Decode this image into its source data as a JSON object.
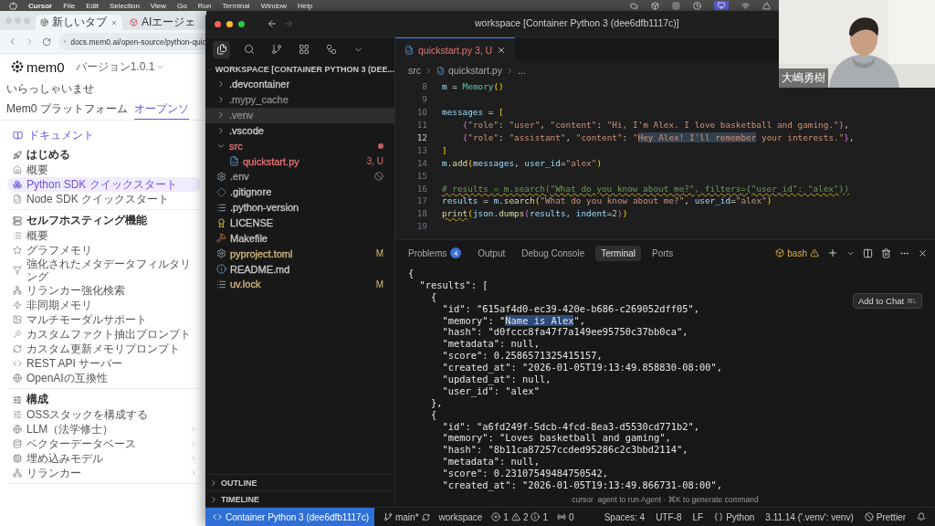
{
  "menubar": {
    "app": "Cursor",
    "items": [
      "File",
      "Edit",
      "Selection",
      "View",
      "Go",
      "Run",
      "Terminal",
      "Window",
      "Help"
    ]
  },
  "browser": {
    "tabs": [
      {
        "label": "新しいタブ",
        "selected": true
      },
      {
        "label": "AIエージェ",
        "selected": false
      }
    ],
    "url": "docs.mem0.ai/open-source/python-quic",
    "logo": "mem0",
    "version": "バージョン1.0.1",
    "nav": [
      {
        "label": "いらっしゃいませ",
        "selected": false
      },
      {
        "label": "Mem0 プラットフォーム",
        "selected": false
      },
      {
        "label": "オープンソ",
        "selected": true
      }
    ],
    "docs_link": "ドキュメント",
    "sections": [
      {
        "title": "はじめる",
        "items": [
          {
            "label": "概要",
            "selected": false
          },
          {
            "label": "Python SDK クイックスタート",
            "selected": true
          },
          {
            "label": "Node SDK クイックスタート",
            "selected": false
          }
        ]
      },
      {
        "title": "セルフホスティング機能",
        "items": [
          {
            "label": "概要",
            "selected": false
          },
          {
            "label": "グラフメモリ",
            "selected": false
          },
          {
            "label": "強化されたメタデータフィルタリング",
            "selected": false
          },
          {
            "label": "リランカー強化検索",
            "selected": false
          },
          {
            "label": "非同期メモリ",
            "selected": false
          },
          {
            "label": "マルチモーダルサポート",
            "selected": false
          },
          {
            "label": "カスタムファクト抽出プロンプト",
            "selected": false
          },
          {
            "label": "カスタム更新メモリプロンプト",
            "selected": false
          },
          {
            "label": "REST API サーバー",
            "selected": false
          },
          {
            "label": "OpenAIの互換性",
            "selected": false
          }
        ]
      },
      {
        "title": "構成",
        "items": [
          {
            "label": "OSSスタックを構成する",
            "selected": false,
            "expandable": false
          },
          {
            "label": "LLM（法学修士）",
            "selected": false,
            "expandable": true
          },
          {
            "label": "ベクターデータベース",
            "selected": false,
            "expandable": true
          },
          {
            "label": "埋め込みモデル",
            "selected": false,
            "expandable": true
          },
          {
            "label": "リランカー",
            "selected": false,
            "expandable": true
          }
        ]
      }
    ]
  },
  "editor": {
    "title": "workspace [Container Python 3 (dee6dfb1117c)]",
    "explorer": {
      "root": "WORKSPACE [CONTAINER PYTHON 3 (DEE...",
      "expanded": true,
      "items": [
        {
          "kind": "folder",
          "name": ".devcontainer",
          "expanded": false,
          "color": "#cccccc",
          "dot": false,
          "excluded": false,
          "selected": false
        },
        {
          "kind": "folder",
          "name": ".mypy_cache",
          "expanded": false,
          "color": "#8a8a8a",
          "dot": false,
          "excluded": false,
          "selected": false
        },
        {
          "kind": "folder",
          "name": ".venv",
          "expanded": false,
          "color": "#8a8a8a",
          "dot": false,
          "excluded": false,
          "selected": true
        },
        {
          "kind": "folder",
          "name": ".vscode",
          "expanded": false,
          "color": "#cccccc",
          "dot": false,
          "excluded": false,
          "selected": false
        },
        {
          "kind": "folder",
          "name": "src",
          "expanded": true,
          "color": "#e57373",
          "dot": true,
          "excluded": false,
          "selected": false,
          "children": [
            {
              "kind": "python",
              "name": "quickstart.py",
              "color": "#e57373",
              "badge": "3, U",
              "dot": false,
              "excluded": false,
              "selected": false
            }
          ]
        },
        {
          "kind": "config",
          "name": ".env",
          "color": "#a0a0a0",
          "dot": false,
          "excluded": true,
          "selected": false
        },
        {
          "kind": "git",
          "name": ".gitignore",
          "color": "#cccccc",
          "dot": false,
          "excluded": false,
          "selected": false
        },
        {
          "kind": "text",
          "name": ".python-version",
          "color": "#cccccc",
          "dot": false,
          "excluded": false,
          "selected": false
        },
        {
          "kind": "license",
          "name": "LICENSE",
          "color": "#cccccc",
          "dot": false,
          "excluded": false,
          "selected": false
        },
        {
          "kind": "makefile",
          "name": "Makefile",
          "color": "#cccccc",
          "dot": false,
          "excluded": false,
          "selected": false
        },
        {
          "kind": "config",
          "name": "pyproject.toml",
          "color": "#d7ba7d",
          "badge": "M",
          "dot": false,
          "excluded": false,
          "selected": false
        },
        {
          "kind": "info",
          "name": "README.md",
          "color": "#cccccc",
          "dot": false,
          "excluded": false,
          "selected": false
        },
        {
          "kind": "text",
          "name": "uv.lock",
          "color": "#d7ba7d",
          "badge": "M",
          "dot": false,
          "excluded": false,
          "selected": false
        }
      ]
    },
    "outline_sections": [
      "OUTLINE",
      "TIMELINE"
    ],
    "tab": {
      "label": "quickstart.py",
      "badge": "3, U"
    },
    "breadcrumb": [
      "src",
      "quickstart.py",
      "..."
    ],
    "code": [
      {
        "number": "8",
        "current": false,
        "tokens": [
          {
            "kind": "var",
            "text": "m"
          },
          {
            "kind": "plain",
            "text": " = "
          },
          {
            "kind": "cls",
            "text": "Memory"
          },
          {
            "kind": "bracket",
            "text": "()"
          }
        ]
      },
      {
        "number": "9",
        "current": false
      },
      {
        "number": "10",
        "current": false,
        "tokens": [
          {
            "kind": "var",
            "text": "messages"
          },
          {
            "kind": "plain",
            "text": " = "
          },
          {
            "kind": "bracket",
            "text": "["
          }
        ]
      },
      {
        "number": "11",
        "current": false,
        "tokens": [
          {
            "kind": "brace",
            "text": "    {"
          },
          {
            "kind": "str",
            "text": "\"role\""
          },
          {
            "kind": "plain",
            "text": ": "
          },
          {
            "kind": "str",
            "text": "\"user\""
          },
          {
            "kind": "plain",
            "text": ", "
          },
          {
            "kind": "str",
            "text": "\"content\""
          },
          {
            "kind": "plain",
            "text": ": "
          },
          {
            "kind": "str",
            "text": "\"Hi, I'm Alex. I love basketball and gaming.\""
          },
          {
            "kind": "brace",
            "text": "}"
          },
          {
            "kind": "plain",
            "text": ","
          }
        ]
      },
      {
        "number": "12",
        "current": true,
        "tokens": [
          {
            "kind": "brace",
            "text": "    {"
          },
          {
            "kind": "str",
            "text": "\"role\""
          },
          {
            "kind": "plain",
            "text": ": "
          },
          {
            "kind": "str",
            "text": "\"assistant\""
          },
          {
            "kind": "plain",
            "text": ", "
          },
          {
            "kind": "str",
            "text": "\"content\""
          },
          {
            "kind": "plain",
            "text": ": "
          },
          {
            "kind": "str",
            "text": "\""
          },
          {
            "kind": "sel",
            "text": "Hey Alex! I'll remember"
          },
          {
            "kind": "str",
            "text": " your interests.\""
          },
          {
            "kind": "brace",
            "text": "}"
          },
          {
            "kind": "plain",
            "text": ","
          }
        ]
      },
      {
        "number": "13",
        "current": false,
        "tokens": [
          {
            "kind": "bracket",
            "text": "]"
          }
        ]
      },
      {
        "number": "14",
        "current": false,
        "tokens": [
          {
            "kind": "var",
            "text": "m"
          },
          {
            "kind": "plain",
            "text": "."
          },
          {
            "kind": "fn",
            "text": "add"
          },
          {
            "kind": "bracket",
            "text": "("
          },
          {
            "kind": "var",
            "text": "messages"
          },
          {
            "kind": "plain",
            "text": ", "
          },
          {
            "kind": "var",
            "text": "user_id"
          },
          {
            "kind": "plain",
            "text": "="
          },
          {
            "kind": "str",
            "text": "\"alex\""
          },
          {
            "kind": "bracket",
            "text": ")"
          }
        ]
      },
      {
        "number": "15",
        "current": false
      },
      {
        "number": "16",
        "current": false,
        "tokens": [
          {
            "kind": "comment",
            "text": "# results = m.search(\"What do you know about me?\", filters={\"user_id\": \"alex\"})"
          }
        ]
      },
      {
        "number": "17",
        "current": false,
        "tokens": [
          {
            "kind": "var",
            "text": "results"
          },
          {
            "kind": "plain",
            "text": " = "
          },
          {
            "kind": "var",
            "text": "m"
          },
          {
            "kind": "plain",
            "text": "."
          },
          {
            "kind": "fn",
            "text": "search"
          },
          {
            "kind": "bracket",
            "text": "("
          },
          {
            "kind": "str",
            "text": "\"What do you know about me?\""
          },
          {
            "kind": "plain",
            "text": ", "
          },
          {
            "kind": "var",
            "text": "user_id"
          },
          {
            "kind": "plain",
            "text": "="
          },
          {
            "kind": "str",
            "text": "\"alex\""
          },
          {
            "kind": "bracket",
            "text": ")"
          }
        ]
      },
      {
        "number": "18",
        "current": false,
        "tokens": [
          {
            "kind": "warnfn",
            "text": "print"
          },
          {
            "kind": "bracket",
            "text": "("
          },
          {
            "kind": "var",
            "text": "json"
          },
          {
            "kind": "plain",
            "text": "."
          },
          {
            "kind": "fn",
            "text": "dumps"
          },
          {
            "kind": "brace",
            "text": "("
          },
          {
            "kind": "var",
            "text": "results"
          },
          {
            "kind": "plain",
            "text": ", "
          },
          {
            "kind": "var",
            "text": "indent"
          },
          {
            "kind": "plain",
            "text": "="
          },
          {
            "kind": "num",
            "text": "2"
          },
          {
            "kind": "brace",
            "text": ")"
          },
          {
            "kind": "bracket",
            "text": ")"
          }
        ]
      },
      {
        "number": "19",
        "current": false
      }
    ],
    "panel_tabs": [
      {
        "label": "Problems",
        "count": "4",
        "selected": false
      },
      {
        "label": "Output",
        "selected": false
      },
      {
        "label": "Debug Console",
        "selected": false
      },
      {
        "label": "Terminal",
        "selected": true
      },
      {
        "label": "Ports",
        "selected": false
      }
    ],
    "shell": "bash",
    "tooltip": {
      "label": "Add to Chat",
      "shortcut": "⌘L"
    },
    "terminal": [
      {
        "text": "{"
      },
      {
        "text": "  \"results\": ["
      },
      {
        "text": "    {"
      },
      {
        "text": "      \"id\": \"615af4d0-ec39-420e-b686-c269052dff05\","
      },
      {
        "segments": [
          {
            "kind": "plain",
            "text": "      \"memory\": \""
          },
          {
            "kind": "sel",
            "text": "Name is Alex"
          },
          {
            "kind": "plain",
            "text": "\","
          }
        ]
      },
      {
        "text": "      \"hash\": \"d0fccc8fa47f7a149ee95750c37bb0ca\","
      },
      {
        "text": "      \"metadata\": null,"
      },
      {
        "text": "      \"score\": 0.2586571325415157,"
      },
      {
        "text": "      \"created_at\": \"2026-01-05T19:13:49.858830-08:00\","
      },
      {
        "text": "      \"updated_at\": null,"
      },
      {
        "text": "      \"user_id\": \"alex\""
      },
      {
        "text": "    },"
      },
      {
        "text": "    {"
      },
      {
        "text": "      \"id\": \"a6fd249f-5dcb-4fcd-8ea3-d5530cd771b2\","
      },
      {
        "text": "      \"memory\": \"Loves basketball and gaming\","
      },
      {
        "text": "      \"hash\": \"8b11ca87257ccded95286c2c3bbd2114\","
      },
      {
        "text": "      \"metadata\": null,"
      },
      {
        "text": "      \"score\": 0.23107549484750542,"
      },
      {
        "text": "      \"created_at\": \"2026-01-05T19:13:49.866731-08:00\","
      }
    ],
    "terminal_hint": "cursor  agent to run Agent · ⌘K to generate command",
    "status_bar": {
      "remote": "Container Python 3 (dee6dfb1117c)",
      "branch": "main*",
      "folder": "workspace",
      "errors": "1",
      "warnings": "2",
      "infos": "1",
      "ports": "0",
      "right": [
        {
          "kind": "text",
          "label": "Spaces: 4"
        },
        {
          "kind": "text",
          "label": "UTF-8"
        },
        {
          "kind": "text",
          "label": "LF"
        },
        {
          "kind": "language",
          "label": "Python"
        },
        {
          "kind": "text",
          "label": "3.11.14 ('.venv': venv)"
        },
        {
          "kind": "formatter",
          "label": "Prettier"
        }
      ]
    }
  },
  "video": {
    "name": "大嶋勇樹"
  }
}
